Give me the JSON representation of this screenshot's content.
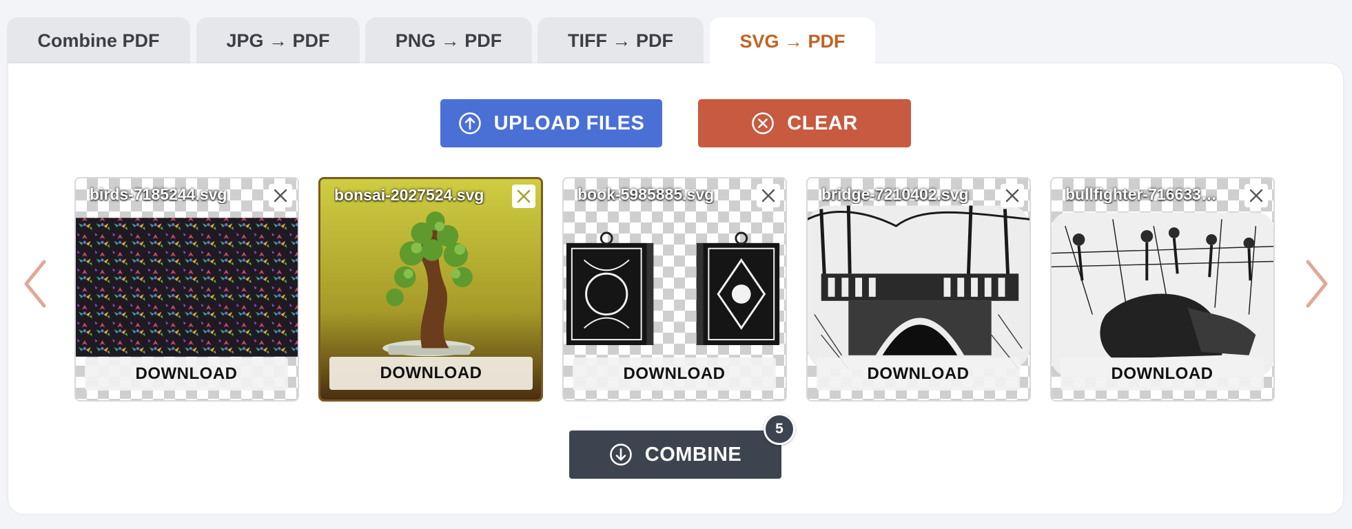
{
  "tabs": [
    {
      "label": "Combine PDF",
      "active": false
    },
    {
      "label": "JPG → PDF",
      "active": false
    },
    {
      "label": "PNG → PDF",
      "active": false
    },
    {
      "label": "TIFF → PDF",
      "active": false
    },
    {
      "label": "SVG → PDF",
      "active": true
    }
  ],
  "toolbar": {
    "upload_label": "UPLOAD FILES",
    "clear_label": "CLEAR"
  },
  "files": [
    {
      "name": "birds-7185244.svg",
      "download_label": "DOWNLOAD",
      "selected": false,
      "art": "colorful-pattern"
    },
    {
      "name": "bonsai-2027524.svg",
      "download_label": "DOWNLOAD",
      "selected": true,
      "art": "bonsai-tree"
    },
    {
      "name": "book-5985885.svg",
      "download_label": "DOWNLOAD",
      "selected": false,
      "art": "ornate-books"
    },
    {
      "name": "bridge-7210402.svg",
      "download_label": "DOWNLOAD",
      "selected": false,
      "art": "stone-bridge"
    },
    {
      "name": "bullfighter-716633…",
      "download_label": "DOWNLOAD",
      "selected": false,
      "art": "bullfight-scene"
    }
  ],
  "combine": {
    "label": "COMBINE",
    "count": "5"
  },
  "colors": {
    "accent_tab": "#c4611e",
    "upload": "#4a70d6",
    "clear": "#c75a3f",
    "combine": "#3e4350",
    "arrows": "#e0a898"
  },
  "icons": {
    "upload": "arrow-up-circle-icon",
    "clear": "x-circle-icon",
    "combine": "arrow-down-circle-icon",
    "prev": "chevron-left-icon",
    "next": "chevron-right-icon",
    "remove": "close-icon"
  }
}
